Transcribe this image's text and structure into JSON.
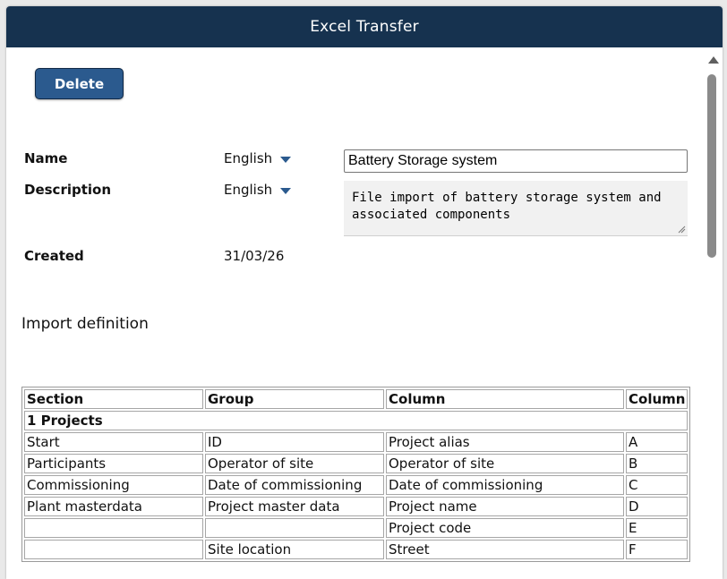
{
  "window": {
    "title": "Excel Transfer"
  },
  "toolbar": {
    "delete_label": "Delete"
  },
  "form": {
    "name_label": "Name",
    "name_lang": "English",
    "name_value": "Battery Storage system",
    "description_label": "Description",
    "description_lang": "English",
    "description_value": "File import of battery storage system and associated components",
    "created_label": "Created",
    "created_value": "31/03/26"
  },
  "import_definition": {
    "title": "Import definition",
    "headers": [
      "Section",
      "Group",
      "Column",
      "Column"
    ],
    "group_label": "1 Projects",
    "rows": [
      [
        "Start",
        "ID",
        "Project alias",
        "A"
      ],
      [
        "Participants",
        "Operator of site",
        "Operator of site",
        "B"
      ],
      [
        "Commissioning",
        "Date of commissioning",
        "Date of commissioning",
        "C"
      ],
      [
        "Plant masterdata",
        "Project master data",
        "Project name",
        "D"
      ],
      [
        "",
        "",
        "Project code",
        "E"
      ],
      [
        "",
        "Site location",
        "Street",
        "F"
      ]
    ]
  },
  "icons": {
    "language_dropdown": "caret-down-icon",
    "scroll_up": "arrow-up-icon",
    "resize": "resize-grip-icon"
  },
  "colors": {
    "titlebar": "#16324f",
    "button": "#2b5a8e",
    "caret": "#2b5a8e"
  }
}
